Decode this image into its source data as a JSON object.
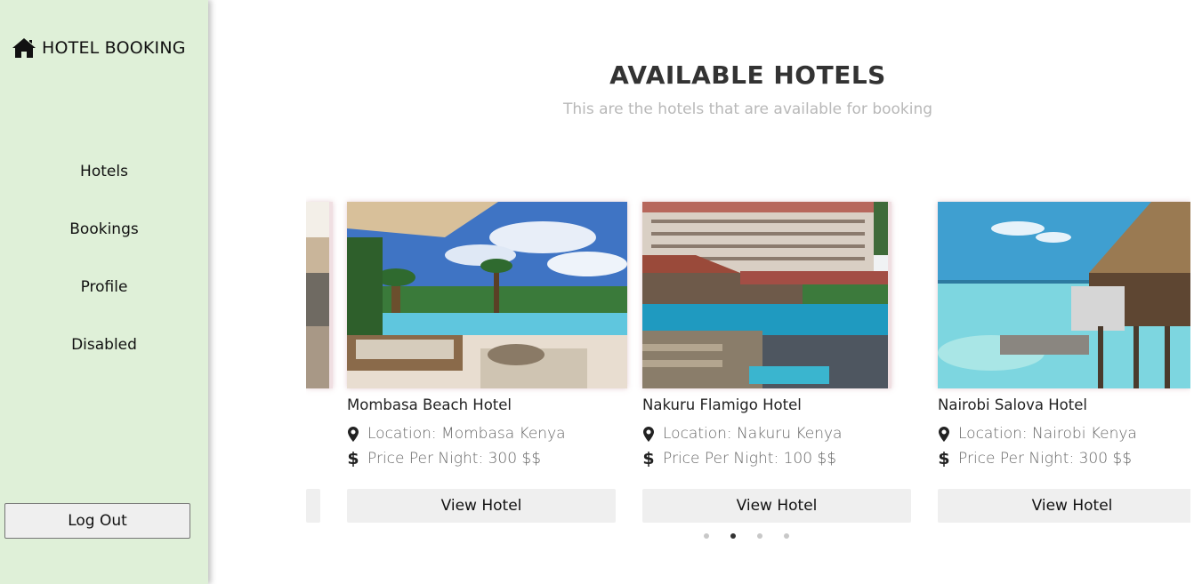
{
  "sidebar": {
    "brand_icon": "home-icon",
    "brand_label": "HOTEL BOOKING",
    "nav": [
      {
        "label": "Hotels"
      },
      {
        "label": "Bookings"
      },
      {
        "label": "Profile"
      },
      {
        "label": "Disabled"
      }
    ],
    "logout_label": "Log Out"
  },
  "header": {
    "title": "AVAILABLE HOTELS",
    "subtitle": "This are the hotels that are available for booking"
  },
  "hotels": [
    {
      "name": "Mombasa Beach Hotel",
      "location": "Location: Mombasa Kenya",
      "price": "Price Per Night: 300 $$",
      "button": "View Hotel"
    },
    {
      "name": "Nakuru Flamigo Hotel",
      "location": "Location: Nakuru Kenya",
      "price": "Price Per Night: 100 $$",
      "button": "View Hotel"
    },
    {
      "name": "Nairobi Salova Hotel",
      "location": "Location: Nairobi Kenya",
      "price": "Price Per Night: 300 $$",
      "button": "View Hotel"
    }
  ],
  "icons": {
    "location": "map-marker-icon",
    "price": "dollar-icon"
  },
  "carousel": {
    "slide_count": 4,
    "active_index": 1
  },
  "colors": {
    "sidebar_bg": "#dff0d8",
    "button_bg": "#efefef",
    "title": "#333333",
    "subtitle": "#b8b8b8"
  }
}
